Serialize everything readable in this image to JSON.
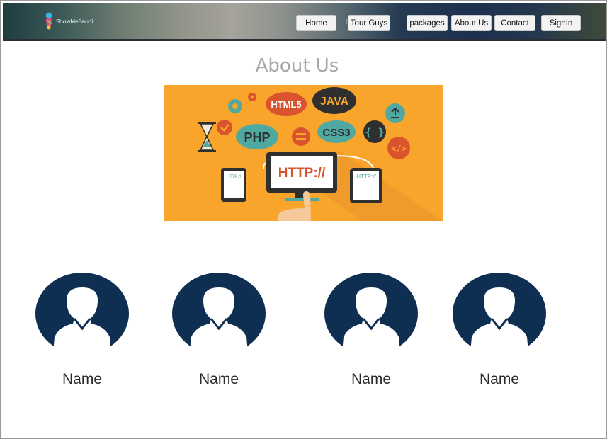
{
  "header": {
    "logo_text": "ShowMeSaudi",
    "nav_ghost": "H",
    "nav": [
      {
        "label": "Home"
      },
      {
        "label": "Tour Guys"
      },
      {
        "label": "packages"
      },
      {
        "label": "About Us"
      },
      {
        "label": "Contact"
      },
      {
        "label": "SignIn"
      }
    ]
  },
  "main": {
    "title": "About Us",
    "hero": {
      "labels": {
        "html5": "HTML5",
        "java": "JAVA",
        "php": "PHP",
        "css3": "CSS3",
        "braces": "{ }",
        "code": "</>",
        "http_main": "HTTP://",
        "http_left": "HTTP://",
        "http_right": "HTTP://"
      },
      "colors": {
        "background": "#f9a52b",
        "teal": "#4fa9a0",
        "red": "#d9532e",
        "dark": "#2f2f2f"
      }
    },
    "team": [
      {
        "name": "Name"
      },
      {
        "name": "Name"
      },
      {
        "name": "Name"
      },
      {
        "name": "Name"
      }
    ],
    "avatar_color": "#0f2f52"
  }
}
